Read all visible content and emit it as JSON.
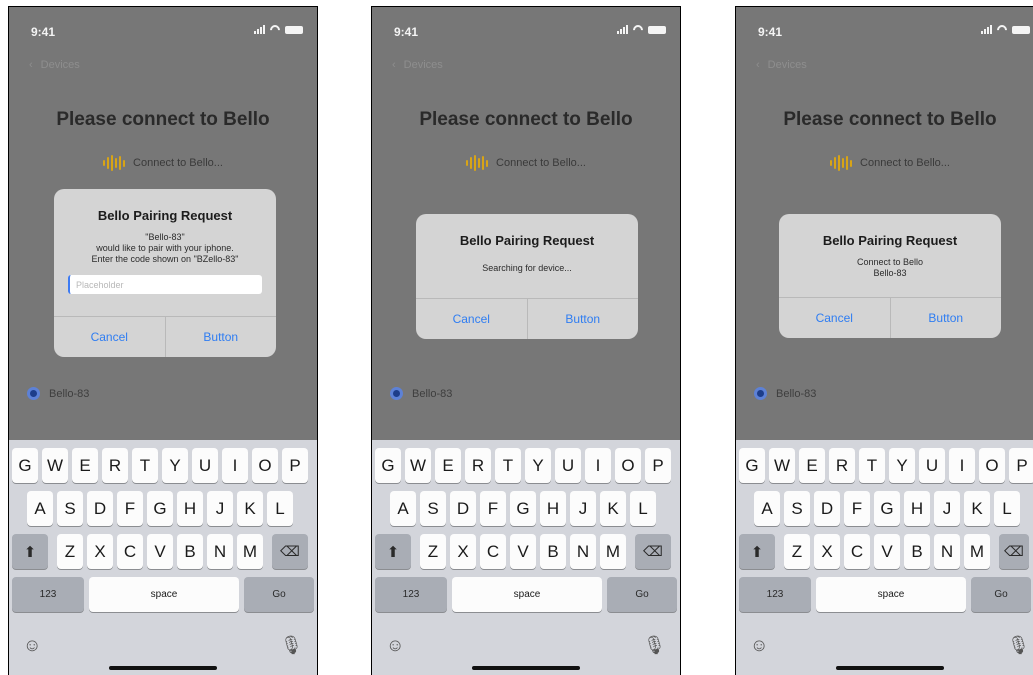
{
  "status": {
    "time": "9:41"
  },
  "nav": {
    "back_label": "Devices"
  },
  "page": {
    "title": "Please connect to Bello",
    "connecting": "Connect to Bello..."
  },
  "device": {
    "name": "Bello-83"
  },
  "dialogs": [
    {
      "title": "Bello Pairing Request",
      "message_lines": [
        "\"Bello-83\"",
        "would like to pair with your iphone.",
        "Enter the code shown on \"BZello-83\""
      ],
      "input_placeholder": "Placeholder",
      "cancel": "Cancel",
      "button": "Button"
    },
    {
      "title": "Bello Pairing Request",
      "message_lines": [
        "Searching for device..."
      ],
      "cancel": "Cancel",
      "button": "Button"
    },
    {
      "title": "Bello Pairing Request",
      "message_lines": [
        "Connect to Bello",
        "Bello-83"
      ],
      "cancel": "Cancel",
      "button": "Button"
    }
  ],
  "keyboard": {
    "row1": [
      "G",
      "W",
      "E",
      "R",
      "T",
      "Y",
      "U",
      "I",
      "O",
      "P"
    ],
    "row2": [
      "A",
      "S",
      "D",
      "F",
      "G",
      "H",
      "J",
      "K",
      "L"
    ],
    "row3": [
      "Z",
      "X",
      "C",
      "V",
      "B",
      "N",
      "M"
    ],
    "numbers_key": "123",
    "space_key": "space",
    "go_key": "Go",
    "icons": {
      "shift": "shift-icon",
      "delete": "delete-icon",
      "emoji": "emoji-icon",
      "mic": "microphone-icon"
    }
  },
  "colors": {
    "overlay": "#777777",
    "dialog": "#d4d4d4",
    "button_text": "#2f7df2",
    "wave_icon": "#d8a416",
    "device_dot": "#1d3d8a",
    "keyboard_bg": "#d3d5db"
  }
}
